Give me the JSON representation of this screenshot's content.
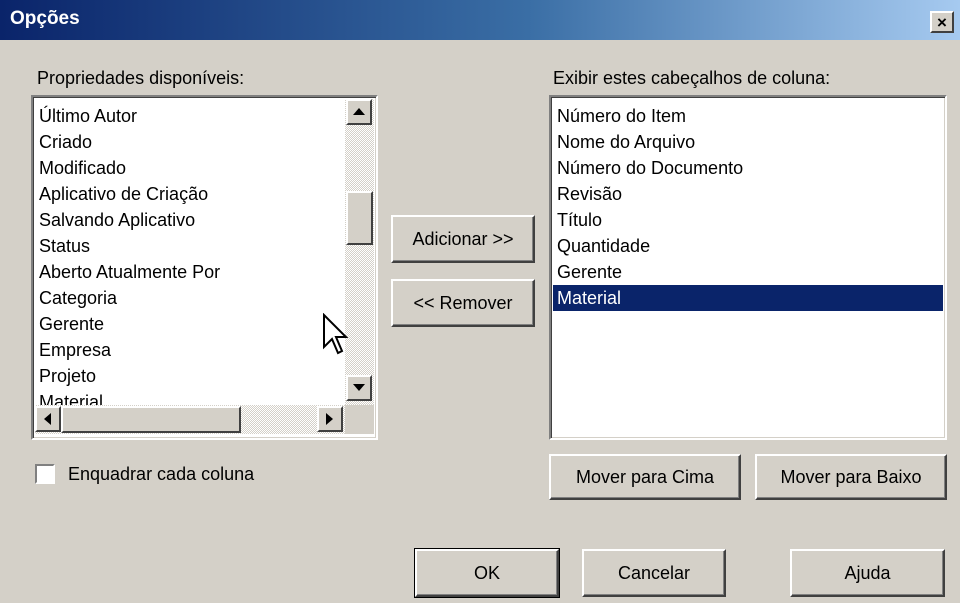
{
  "window": {
    "title": "Opções",
    "close_glyph": "×"
  },
  "available": {
    "label": "Propriedades disponíveis:",
    "items": [
      "Último Autor",
      "Criado",
      "Modificado",
      "Aplicativo de Criação",
      "Salvando Aplicativo",
      "Status",
      "Aberto Atualmente Por",
      "Categoria",
      "Gerente",
      "Empresa",
      "Projeto",
      "Material"
    ]
  },
  "columns": {
    "label": "Exibir estes cabeçalhos de coluna:",
    "items": [
      "Número do Item",
      "Nome do Arquivo",
      "Número do Documento",
      "Revisão",
      "Título",
      "Quantidade",
      "Gerente",
      "Material"
    ],
    "selected_index": 7
  },
  "buttons": {
    "add": "Adicionar >>",
    "remove": "<< Remover",
    "move_up": "Mover para Cima",
    "move_down": "Mover para Baixo",
    "ok": "OK",
    "cancel": "Cancelar",
    "help": "Ajuda"
  },
  "wrap_columns": {
    "label": "Enquadrar cada coluna",
    "checked": false
  },
  "colors": {
    "selection": "#0a246a",
    "face": "#d4d0c8",
    "titlebar": "#0a246a"
  },
  "icons": [
    "close-icon",
    "scroll-up-arrow-icon",
    "scroll-down-arrow-icon",
    "scroll-left-arrow-icon",
    "scroll-right-arrow-icon",
    "mouse-pointer-icon"
  ]
}
